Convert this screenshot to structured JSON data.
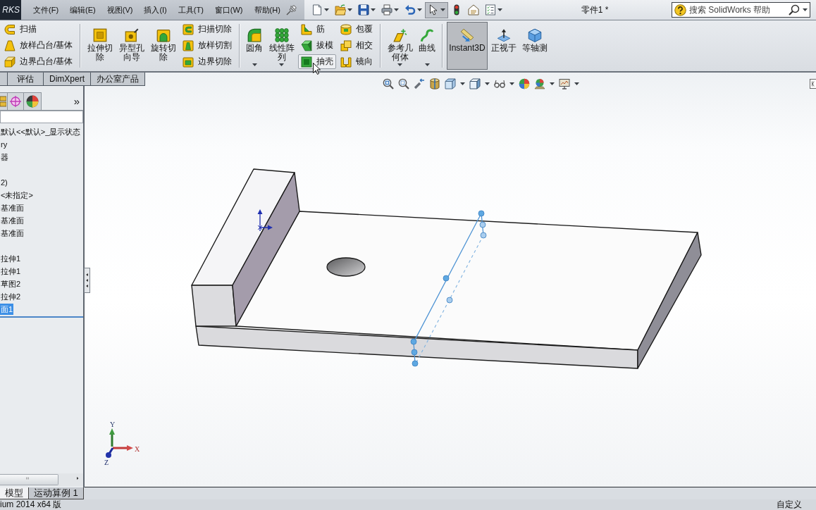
{
  "logo": "RKS",
  "menu": [
    "文件(F)",
    "编辑(E)",
    "视图(V)",
    "插入(I)",
    "工具(T)",
    "窗口(W)",
    "帮助(H)"
  ],
  "quick_access": [
    {
      "pressed": false,
      "dropdown": true
    },
    {
      "pressed": false,
      "dropdown": true
    },
    {
      "pressed": false,
      "dropdown": true
    },
    {
      "pressed": false,
      "dropdown": true
    },
    {
      "pressed": false,
      "dropdown": true
    },
    {
      "pressed": true,
      "dropdown": true
    },
    {
      "pressed": false,
      "dropdown": false
    },
    {
      "pressed": false,
      "dropdown": false
    },
    {
      "pressed": false,
      "dropdown": true
    }
  ],
  "title": "零件1 *",
  "search": {
    "placeholder": "搜索 SolidWorks 帮助"
  },
  "ribbon": [
    {
      "columns": [
        {
          "kind": "stack",
          "items": [
            {
              "label": "扫描",
              "hovered": false
            },
            {
              "label": "放样凸台/基体",
              "hovered": false
            },
            {
              "label": "边界凸台/基体",
              "hovered": false
            }
          ]
        }
      ]
    },
    {
      "columns": [
        {
          "kind": "large",
          "label": "拉伸切除",
          "pressed": false,
          "dropdown": false
        },
        {
          "kind": "large",
          "label": "异型孔向导",
          "pressed": false,
          "dropdown": false
        },
        {
          "kind": "large",
          "label": "旋转切除",
          "pressed": false,
          "dropdown": false
        },
        {
          "kind": "stack",
          "items": [
            {
              "label": "扫描切除",
              "hovered": false
            },
            {
              "label": "放样切割",
              "hovered": false
            },
            {
              "label": "边界切除",
              "hovered": false
            }
          ]
        }
      ]
    },
    {
      "columns": [
        {
          "kind": "large",
          "label": "圆角",
          "pressed": false,
          "dropdown": true
        },
        {
          "kind": "large",
          "label": "线性阵列",
          "pressed": false,
          "dropdown": true
        },
        {
          "kind": "stack",
          "items": [
            {
              "label": "筋",
              "hovered": false
            },
            {
              "label": "拔模",
              "hovered": false
            },
            {
              "label": "抽壳",
              "hovered": true
            }
          ]
        },
        {
          "kind": "stack",
          "items": [
            {
              "label": "包覆",
              "hovered": false
            },
            {
              "label": "相交",
              "hovered": false
            },
            {
              "label": "镜向",
              "hovered": false
            }
          ]
        }
      ]
    },
    {
      "columns": [
        {
          "kind": "large",
          "label": "参考几何体",
          "pressed": false,
          "dropdown": true
        },
        {
          "kind": "large",
          "label": "曲线",
          "pressed": false,
          "dropdown": true
        }
      ]
    },
    {
      "columns": [
        {
          "kind": "toggle",
          "label": "Instant3D",
          "pressed": true,
          "dropdown": false
        },
        {
          "kind": "large",
          "label": "正视于",
          "pressed": false,
          "dropdown": false
        },
        {
          "kind": "large",
          "label": "等轴测",
          "pressed": false,
          "dropdown": false
        }
      ]
    }
  ],
  "command_tabs": [
    {
      "label": "评估",
      "selected": false
    },
    {
      "label": "DimXpert",
      "selected": false
    },
    {
      "label": "办公室产品",
      "selected": false
    }
  ],
  "feature_tree": {
    "more": "»",
    "items": [
      {
        "kind": "row",
        "label": "默认<<默认>_显示状态",
        "selected": false
      },
      {
        "kind": "row",
        "label": "ry",
        "selected": false
      },
      {
        "kind": "row",
        "label": "器",
        "selected": false
      },
      {
        "kind": "blank"
      },
      {
        "kind": "row",
        "label": "2)",
        "selected": false
      },
      {
        "kind": "row",
        "label": "<未指定>",
        "selected": false
      },
      {
        "kind": "row",
        "label": "基准面",
        "selected": false
      },
      {
        "kind": "row",
        "label": "基准面",
        "selected": false
      },
      {
        "kind": "row",
        "label": "基准面",
        "selected": false
      },
      {
        "kind": "blank"
      },
      {
        "kind": "row",
        "label": "拉伸1",
        "selected": false
      },
      {
        "kind": "row",
        "label": "拉伸1",
        "selected": false
      },
      {
        "kind": "row",
        "label": "草图2",
        "selected": false
      },
      {
        "kind": "row",
        "label": "拉伸2",
        "selected": false
      },
      {
        "kind": "row",
        "label": "面1",
        "selected": true
      }
    ]
  },
  "triad": {
    "x": "X",
    "y": "Y",
    "z": "Z"
  },
  "bottom_tabs": [
    {
      "label": "模型",
      "selected": true
    },
    {
      "label": "运动算例 1",
      "selected": false
    }
  ],
  "status_bar": {
    "left": "ium 2014 x64 版",
    "right": "自定义"
  }
}
